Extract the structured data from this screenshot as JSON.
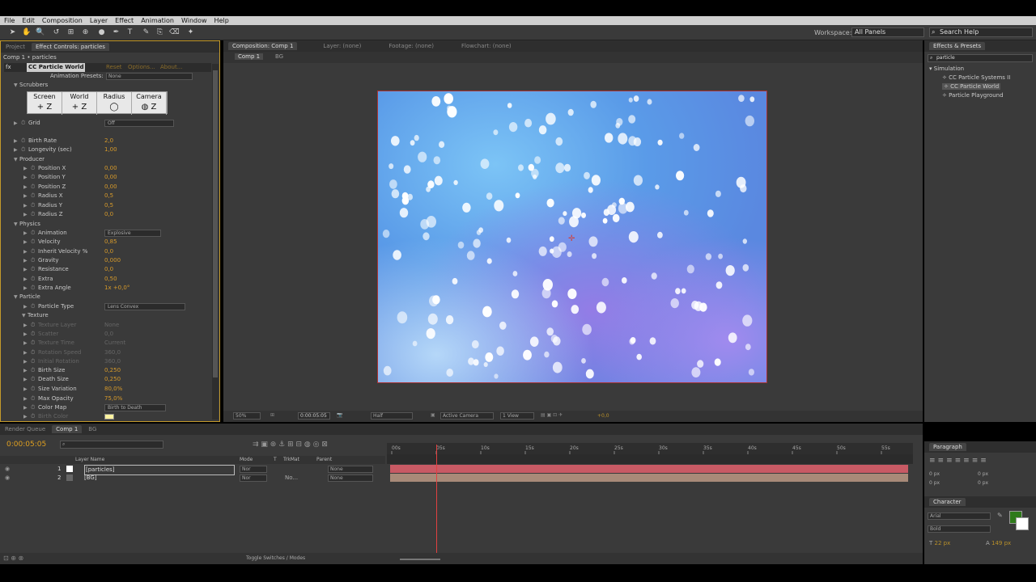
{
  "menu": [
    "File",
    "Edit",
    "Composition",
    "Layer",
    "Effect",
    "Animation",
    "Window",
    "Help"
  ],
  "workspace": {
    "label": "Workspace:",
    "value": "All Panels",
    "search": "Search Help"
  },
  "left_panel": {
    "tabs": [
      "Project",
      "Effect Controls: particles"
    ],
    "breadcrumb": "Comp 1 • particles",
    "effect_name": "CC Particle World",
    "effect_links": [
      "Reset",
      "Options...",
      "About..."
    ],
    "presets_label": "Animation Presets:",
    "presets_value": "None",
    "scrubbers_label": "Scrubbers",
    "scrub_cells": [
      {
        "title": "Screen",
        "glyphs": "+ Z"
      },
      {
        "title": "World",
        "glyphs": "+ Z"
      },
      {
        "title": "Radius",
        "glyphs": "◯"
      },
      {
        "title": "Camera",
        "glyphs": "◍ Z"
      }
    ],
    "props": [
      {
        "name": "Grid",
        "value": "Off",
        "type": "dropdown"
      },
      {
        "name": "Birth Rate",
        "value": "2,0"
      },
      {
        "name": "Longevity (sec)",
        "value": "1,00"
      },
      {
        "name": "Producer",
        "section": true
      },
      {
        "name": "Position X",
        "value": "0,00"
      },
      {
        "name": "Position Y",
        "value": "0,00"
      },
      {
        "name": "Position Z",
        "value": "0,00"
      },
      {
        "name": "Radius X",
        "value": "0,5"
      },
      {
        "name": "Radius Y",
        "value": "0,5"
      },
      {
        "name": "Radius Z",
        "value": "0,0"
      },
      {
        "name": "Physics",
        "section": true
      },
      {
        "name": "Animation",
        "value": "Explosive",
        "type": "dropdown"
      },
      {
        "name": "Velocity",
        "value": "0,85"
      },
      {
        "name": "Inherit Velocity %",
        "value": "0,0"
      },
      {
        "name": "Gravity",
        "value": "0,000"
      },
      {
        "name": "Resistance",
        "value": "0,0"
      },
      {
        "name": "Extra",
        "value": "0,50"
      },
      {
        "name": "Extra Angle",
        "value": "1x +0,0°"
      },
      {
        "name": "Particle",
        "section": true
      },
      {
        "name": "Particle Type",
        "value": "Lens Convex",
        "type": "dropdown"
      },
      {
        "name": "Texture",
        "section": true
      },
      {
        "name": "Texture Layer",
        "value": "None",
        "dim": true
      },
      {
        "name": "Scatter",
        "value": "0,0",
        "dim": true
      },
      {
        "name": "Texture Time",
        "value": "Current",
        "dim": true
      },
      {
        "name": "Rotation Speed",
        "value": "360,0",
        "dim": true
      },
      {
        "name": "Initial Rotation",
        "value": "360,0",
        "dim": true
      },
      {
        "name": "Birth Size",
        "value": "0,250"
      },
      {
        "name": "Death Size",
        "value": "0,250"
      },
      {
        "name": "Size Variation",
        "value": "80,0%"
      },
      {
        "name": "Max Opacity",
        "value": "75,0%"
      },
      {
        "name": "Color Map",
        "value": "Birth to Death",
        "type": "dropdown"
      },
      {
        "name": "Birth Color",
        "value": "",
        "dim": true
      }
    ]
  },
  "comp_panel": {
    "tabs": [
      "Composition: Comp 1",
      "Layer: (none)",
      "Footage: (none)",
      "Flowchart: (none)"
    ],
    "sub_tabs": [
      "Comp 1",
      "BG"
    ],
    "footer": {
      "zoom": "50%",
      "time": "0:00:05:05",
      "resolution": "Half",
      "camera": "Active Camera",
      "views": "1 View",
      "exposure": "+0,0"
    }
  },
  "effects_presets": {
    "title": "Effects & Presets",
    "search": "particle",
    "category": "Simulation",
    "items": [
      "CC Particle Systems II",
      "CC Particle World",
      "Particle Playground"
    ]
  },
  "timeline": {
    "tabs": [
      "Render Queue",
      "Comp 1",
      "BG"
    ],
    "current_time": "0:00:05:05",
    "columns": {
      "name": "Layer Name",
      "mode": "Mode",
      "t": "T",
      "trkmat": "TrkMat",
      "parent": "Parent"
    },
    "layers": [
      {
        "num": "1",
        "name": "[particles]",
        "mode": "Nor",
        "trk": "",
        "parent": "None",
        "bar_color": "#c85a64"
      },
      {
        "num": "2",
        "name": "[BG]",
        "mode": "Nor",
        "trk": "No...",
        "parent": "None",
        "bar_color": "#a88a78"
      }
    ],
    "ruler": [
      "00s",
      "05s",
      "10s",
      "15s",
      "20s",
      "25s",
      "30s",
      "35s",
      "40s",
      "45s",
      "50s",
      "55s"
    ],
    "playhead_fraction": 0.0945,
    "toggle_label": "Toggle Switches / Modes"
  },
  "paragraph": {
    "title": "Paragraph",
    "indent_values": [
      "0 px",
      "0 px",
      "0 px",
      "0 px",
      "0 px"
    ]
  },
  "character": {
    "title": "Character",
    "font": "Arial",
    "style": "Bold",
    "size": "22 px",
    "leading": "149 px",
    "fill_color": "#2e7a1a"
  }
}
